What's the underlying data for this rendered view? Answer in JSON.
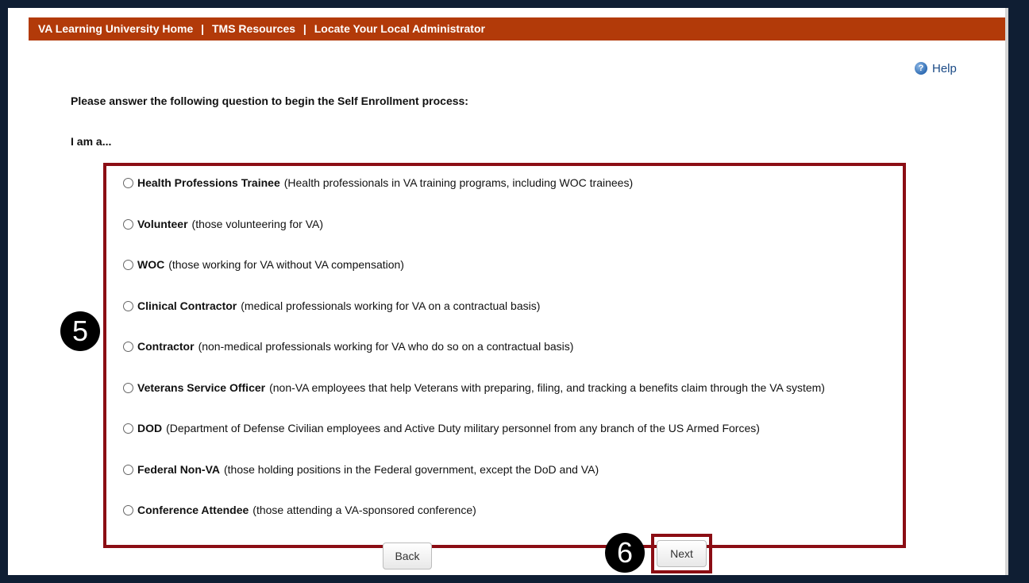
{
  "header": {
    "links": [
      "VA Learning University Home",
      "TMS Resources",
      "Locate Your Local Administrator"
    ],
    "separator": "|"
  },
  "help": {
    "label": "Help",
    "icon": "help-icon"
  },
  "prompt": "Please answer the following question to begin the Self Enrollment process:",
  "question": "I am a...",
  "options": [
    {
      "title": "Health Professions Trainee",
      "desc": "(Health professionals in VA training programs, including WOC trainees)"
    },
    {
      "title": "Volunteer",
      "desc": "(those volunteering for VA)"
    },
    {
      "title": "WOC",
      "desc": "(those working for VA without VA compensation)"
    },
    {
      "title": "Clinical Contractor",
      "desc": "(medical professionals working for VA on a contractual basis)"
    },
    {
      "title": "Contractor",
      "desc": "(non-medical professionals working for VA who do so on a contractual basis)"
    },
    {
      "title": "Veterans Service Officer",
      "desc": "(non-VA employees that help Veterans with preparing, filing, and tracking a benefits claim through the VA system)"
    },
    {
      "title": "DOD",
      "desc": "(Department of Defense Civilian employees and Active Duty military personnel from any branch of the US Armed Forces)"
    },
    {
      "title": "Federal Non-VA",
      "desc": "(those holding positions in the Federal government, except the DoD and VA)"
    },
    {
      "title": "Conference Attendee",
      "desc": "(those attending a VA-sponsored conference)"
    }
  ],
  "callouts": {
    "step5": "5",
    "step6": "6"
  },
  "buttons": {
    "back": "Back",
    "next": "Next"
  },
  "colors": {
    "header": "#b23a09",
    "highlight": "#8b0d14",
    "link": "#1a4a86"
  }
}
